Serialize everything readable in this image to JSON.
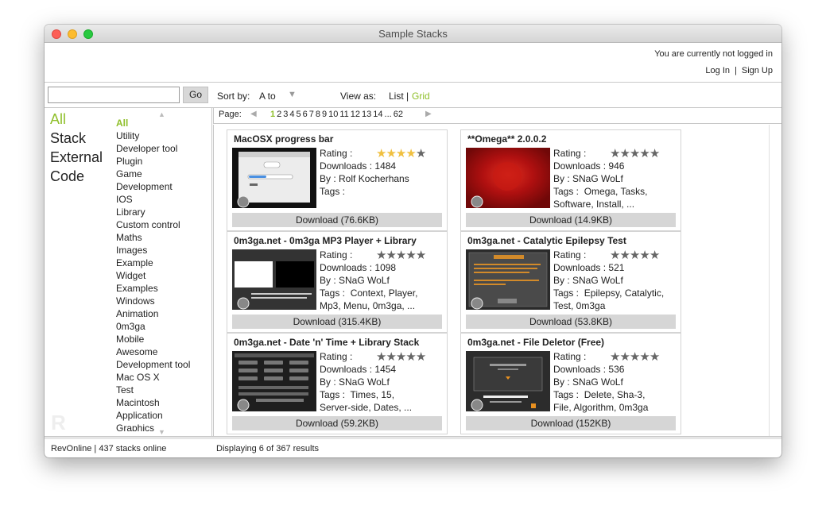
{
  "window": {
    "title": "Sample Stacks"
  },
  "account": {
    "status": "You are currently not logged in",
    "login": "Log In",
    "signup": "Sign Up",
    "separator": "|"
  },
  "search": {
    "value": "",
    "go_label": "Go"
  },
  "sort": {
    "label": "Sort by:",
    "value": "A to",
    "arrow": "▼"
  },
  "view": {
    "label": "View as:",
    "list": "List",
    "separator": "|",
    "grid": "Grid"
  },
  "types": [
    "All",
    "Stack",
    "External",
    "Code"
  ],
  "categories": [
    "All",
    "Utility",
    "Developer tool",
    "Plugin",
    "Game",
    "Development",
    "IOS",
    "Library",
    "Custom control",
    "Maths",
    "Images",
    "Example",
    "Widget",
    "Examples",
    "Windows",
    "Animation",
    "0m3ga",
    "Mobile",
    "Awesome",
    "Development tool",
    "Mac OS X",
    "Test",
    "Macintosh",
    "Application",
    "Graphics"
  ],
  "pagination": {
    "label": "Page:",
    "pages": [
      "1",
      "2",
      "3",
      "4",
      "5",
      "6",
      "7",
      "8",
      "9",
      "10",
      "11",
      "12",
      "13",
      "14",
      "...",
      "62"
    ],
    "current": "1"
  },
  "stacks": [
    {
      "title": "MacOSX progress bar",
      "rating_label": "Rating :",
      "rating": 4,
      "downloads_label": "Downloads :",
      "downloads": "1484",
      "by_label": "By :",
      "author": "Rolf Kocherhans",
      "tags_label": "Tags :",
      "tags_line1": "",
      "tags_line2": "",
      "download": "Download  (76.6KB)"
    },
    {
      "title": "**Omega** 2.0.0.2",
      "rating_label": "Rating :",
      "rating": 0,
      "downloads_label": "Downloads :",
      "downloads": "946",
      "by_label": "By :",
      "author": "SNaG WoLf",
      "tags_label": "Tags :",
      "tags_line1": "Omega, Tasks,",
      "tags_line2": "Software, Install, ...",
      "download": "Download  (14.9KB)"
    },
    {
      "title": "0m3ga.net - 0m3ga MP3 Player + Library",
      "rating_label": "Rating :",
      "rating": 0,
      "downloads_label": "Downloads :",
      "downloads": "1098",
      "by_label": "By :",
      "author": "SNaG WoLf",
      "tags_label": "Tags :",
      "tags_line1": "Context, Player,",
      "tags_line2": "Mp3, Menu, 0m3ga, ...",
      "download": "Download  (315.4KB)"
    },
    {
      "title": "0m3ga.net - Catalytic Epilepsy Test",
      "rating_label": "Rating :",
      "rating": 0,
      "downloads_label": "Downloads :",
      "downloads": "521",
      "by_label": "By :",
      "author": "SNaG WoLf",
      "tags_label": "Tags :",
      "tags_line1": "Epilepsy, Catalytic,",
      "tags_line2": "Test, 0m3ga",
      "download": "Download  (53.8KB)"
    },
    {
      "title": "0m3ga.net - Date 'n' Time + Library Stack",
      "rating_label": "Rating :",
      "rating": 0,
      "downloads_label": "Downloads :",
      "downloads": "1454",
      "by_label": "By :",
      "author": "SNaG WoLf",
      "tags_label": "Tags :",
      "tags_line1": "Times, 15,",
      "tags_line2": "Server-side, Dates, ...",
      "download": "Download  (59.2KB)"
    },
    {
      "title": "0m3ga.net - File Deletor (Free)",
      "rating_label": "Rating :",
      "rating": 0,
      "downloads_label": "Downloads :",
      "downloads": "536",
      "by_label": "By :",
      "author": "SNaG WoLf",
      "tags_label": "Tags :",
      "tags_line1": "Delete, Sha-3,",
      "tags_line2": "File, Algorithm, 0m3ga",
      "download": "Download  (152KB)"
    }
  ],
  "status": {
    "left": "RevOnline | 437 stacks online",
    "right": "Displaying 6 of 367 results"
  },
  "colors": {
    "accent": "#8fbf2a",
    "star": "#f0c040"
  }
}
